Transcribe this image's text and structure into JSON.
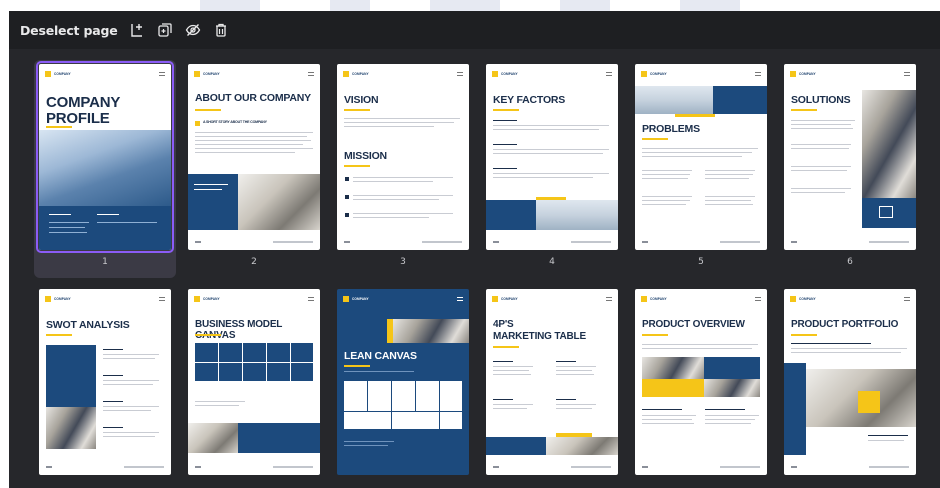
{
  "toolbar": {
    "deselect_label": "Deselect page",
    "icons": [
      "add-page-icon",
      "duplicate-icon",
      "hide-icon",
      "trash-icon"
    ]
  },
  "colors": {
    "background": "#1e1f22",
    "selection": "#8b5cf6",
    "navy": "#1c4a7d",
    "accent_yellow": "#f5c518"
  },
  "pages": [
    {
      "number": "1",
      "title": "COMPANY PROFILE",
      "selected": true
    },
    {
      "number": "2",
      "title": "ABOUT OUR COMPANY",
      "subtitle": "A SHORT STORY ABOUT THE COMPANY"
    },
    {
      "number": "3",
      "title": "VISION",
      "title2": "MISSION"
    },
    {
      "number": "4",
      "title": "KEY FACTORS"
    },
    {
      "number": "5",
      "title": "PROBLEMS"
    },
    {
      "number": "6",
      "title": "SOLUTIONS"
    },
    {
      "number": "7",
      "title": "SWOT ANALYSIS"
    },
    {
      "number": "8",
      "title": "BUSINESS MODEL CANVAS"
    },
    {
      "number": "9",
      "title": "LEAN CANVAS"
    },
    {
      "number": "10",
      "title": "4P'S",
      "title2": "MARKETING TABLE"
    },
    {
      "number": "11",
      "title": "PRODUCT OVERVIEW"
    },
    {
      "number": "12",
      "title": "PRODUCT PORTFOLIO"
    }
  ]
}
